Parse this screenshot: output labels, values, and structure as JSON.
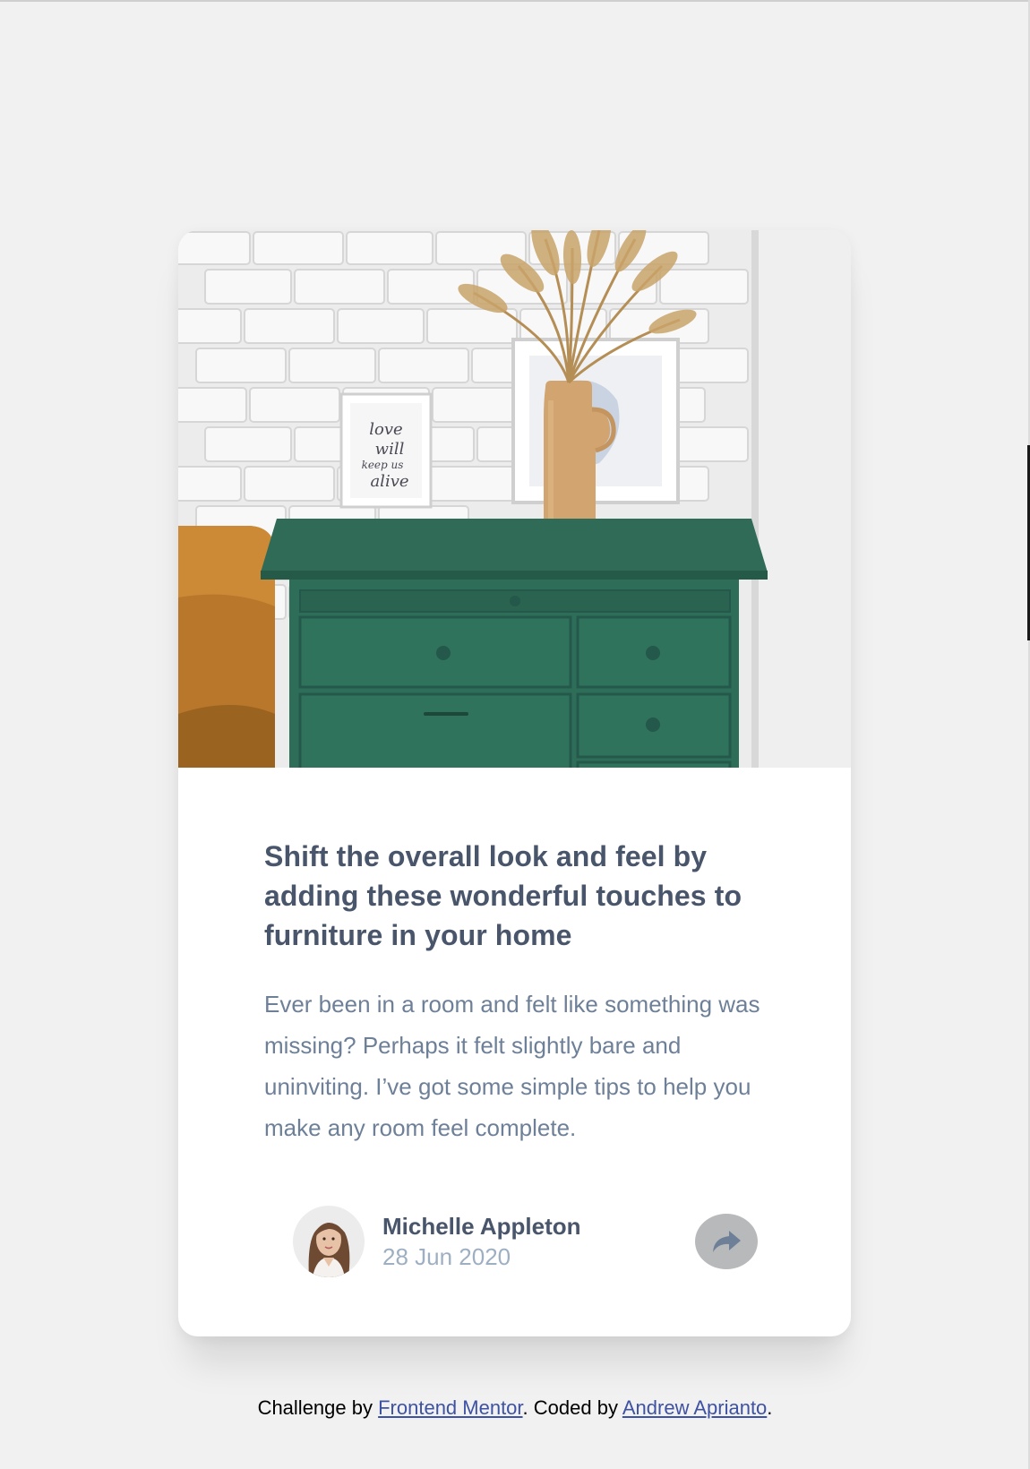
{
  "article": {
    "image_alt": "Green drawers with vase and frames",
    "title": "Shift the overall look and feel by adding these wonderful touches to furniture in your home",
    "description": "Ever been in a room and felt like something was missing? Perhaps it felt slightly bare and uninviting. I’ve got some simple tips to help you make any room feel complete.",
    "frame_text": [
      "love",
      "will",
      "keep us",
      "alive"
    ]
  },
  "author": {
    "name": "Michelle Appleton",
    "date": "28 Jun 2020",
    "avatar_icon": "avatar-michelle"
  },
  "share": {
    "icon": "share-icon",
    "background": "#b8b9ba",
    "icon_color": "#6e8098"
  },
  "footer": {
    "prefix": "Challenge by ",
    "link1": "Frontend Mentor",
    "middle": ". Coded by ",
    "link2": "Andrew Aprianto",
    "suffix": "."
  },
  "colors": {
    "background": "#f1f1f1",
    "card": "#ffffff",
    "title": "#48556a",
    "text": "#6e8098",
    "muted": "#9eafc2",
    "link": "#3e52a3",
    "drawer_green": "#2e6e58"
  }
}
